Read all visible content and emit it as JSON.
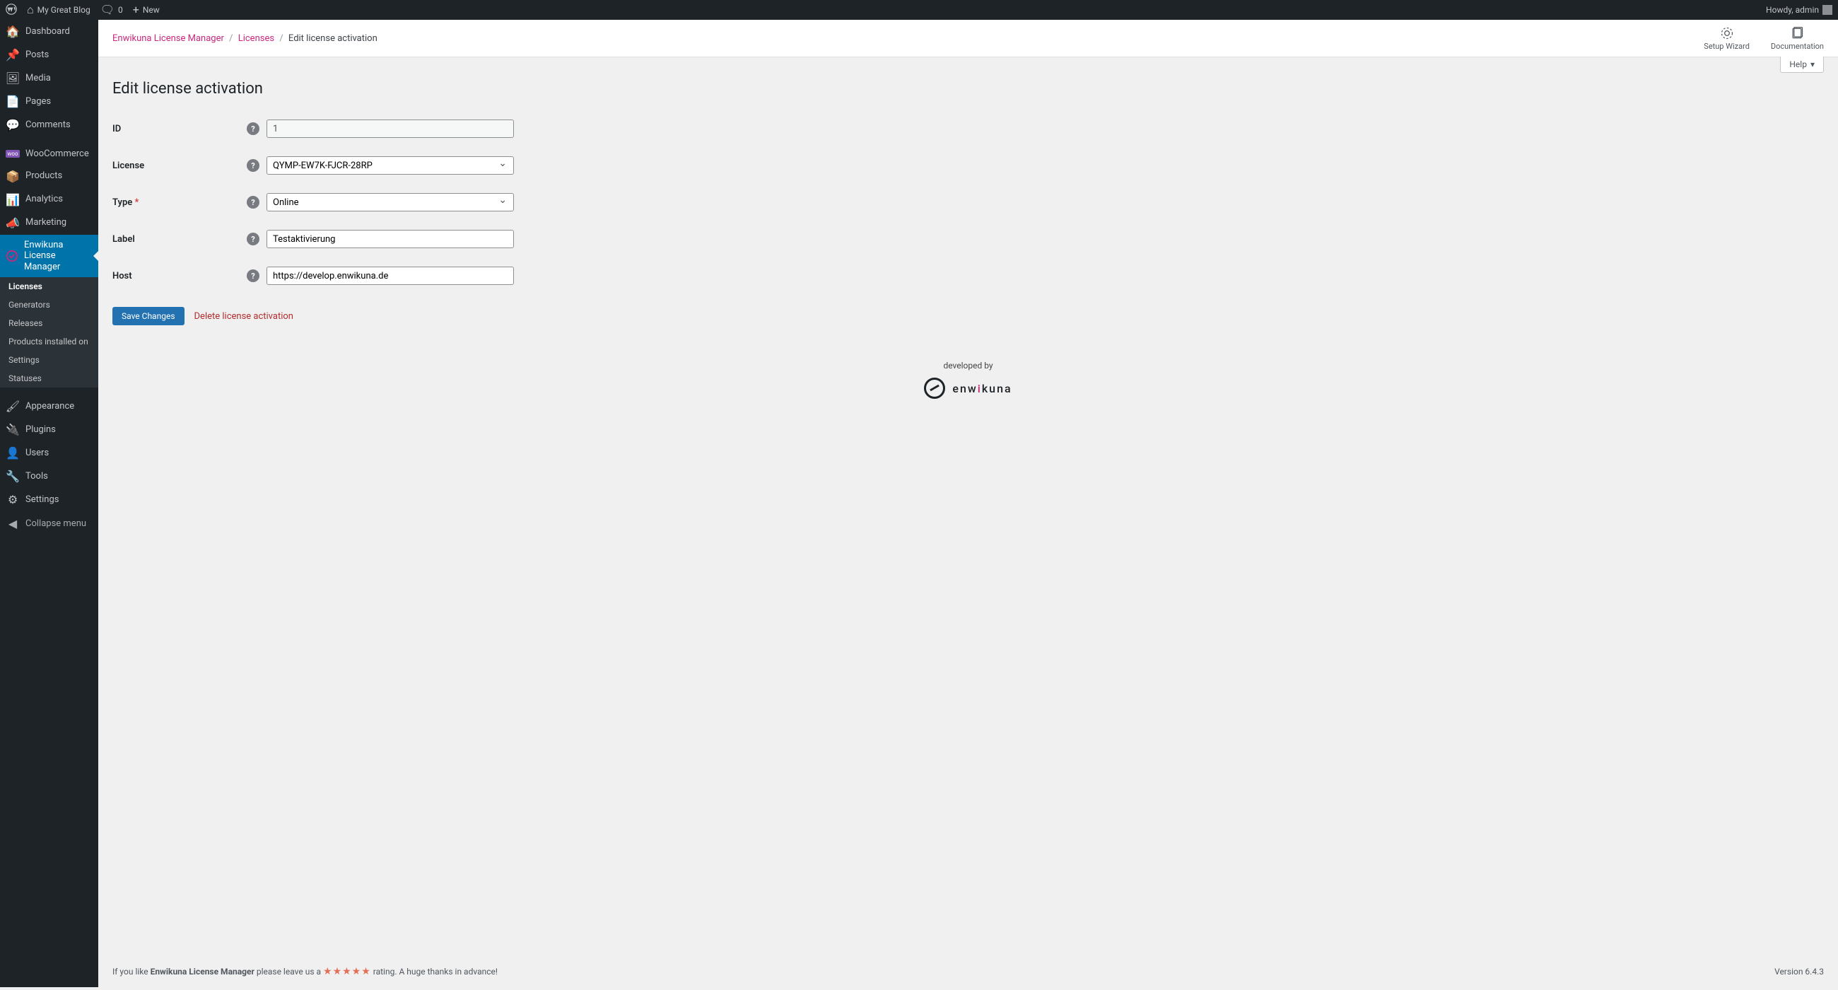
{
  "adminBar": {
    "siteTitle": "My Great Blog",
    "commentsCount": "0",
    "newLabel": "New",
    "howdy": "Howdy, admin"
  },
  "sidebar": {
    "dashboard": "Dashboard",
    "posts": "Posts",
    "media": "Media",
    "pages": "Pages",
    "comments": "Comments",
    "woocommerce": "WooCommerce",
    "products": "Products",
    "analytics": "Analytics",
    "marketing": "Marketing",
    "elm": "Enwikuna License Manager",
    "sub": {
      "licenses": "Licenses",
      "generators": "Generators",
      "releases": "Releases",
      "productsInstalled": "Products installed on",
      "settings": "Settings",
      "statuses": "Statuses"
    },
    "appearance": "Appearance",
    "plugins": "Plugins",
    "users": "Users",
    "tools": "Tools",
    "settings": "Settings",
    "collapse": "Collapse menu"
  },
  "breadcrumbs": {
    "root": "Enwikuna License Manager",
    "parent": "Licenses",
    "current": "Edit license activation"
  },
  "headerActions": {
    "setup": "Setup Wizard",
    "docs": "Documentation"
  },
  "helpLabel": "Help",
  "pageTitle": "Edit license activation",
  "form": {
    "idLabel": "ID",
    "idValue": "1",
    "licenseLabel": "License",
    "licenseValue": "QYMP-EW7K-FJCR-28RP",
    "typeLabel": "Type",
    "typeValue": "Online",
    "labelLabel": "Label",
    "labelValue": "Testaktivierung",
    "hostLabel": "Host",
    "hostValue": "https://develop.enwikuna.de"
  },
  "actions": {
    "save": "Save Changes",
    "delete": "Delete license activation"
  },
  "devBy": "developed by",
  "brand": {
    "pref": "enw",
    "accent": "i",
    "suff": "kuna"
  },
  "footer": {
    "pre": "If you like ",
    "name": "Enwikuna License Manager",
    "mid": " please leave us a ",
    "post": " rating. A huge thanks in advance!",
    "version": "Version 6.4.3"
  }
}
